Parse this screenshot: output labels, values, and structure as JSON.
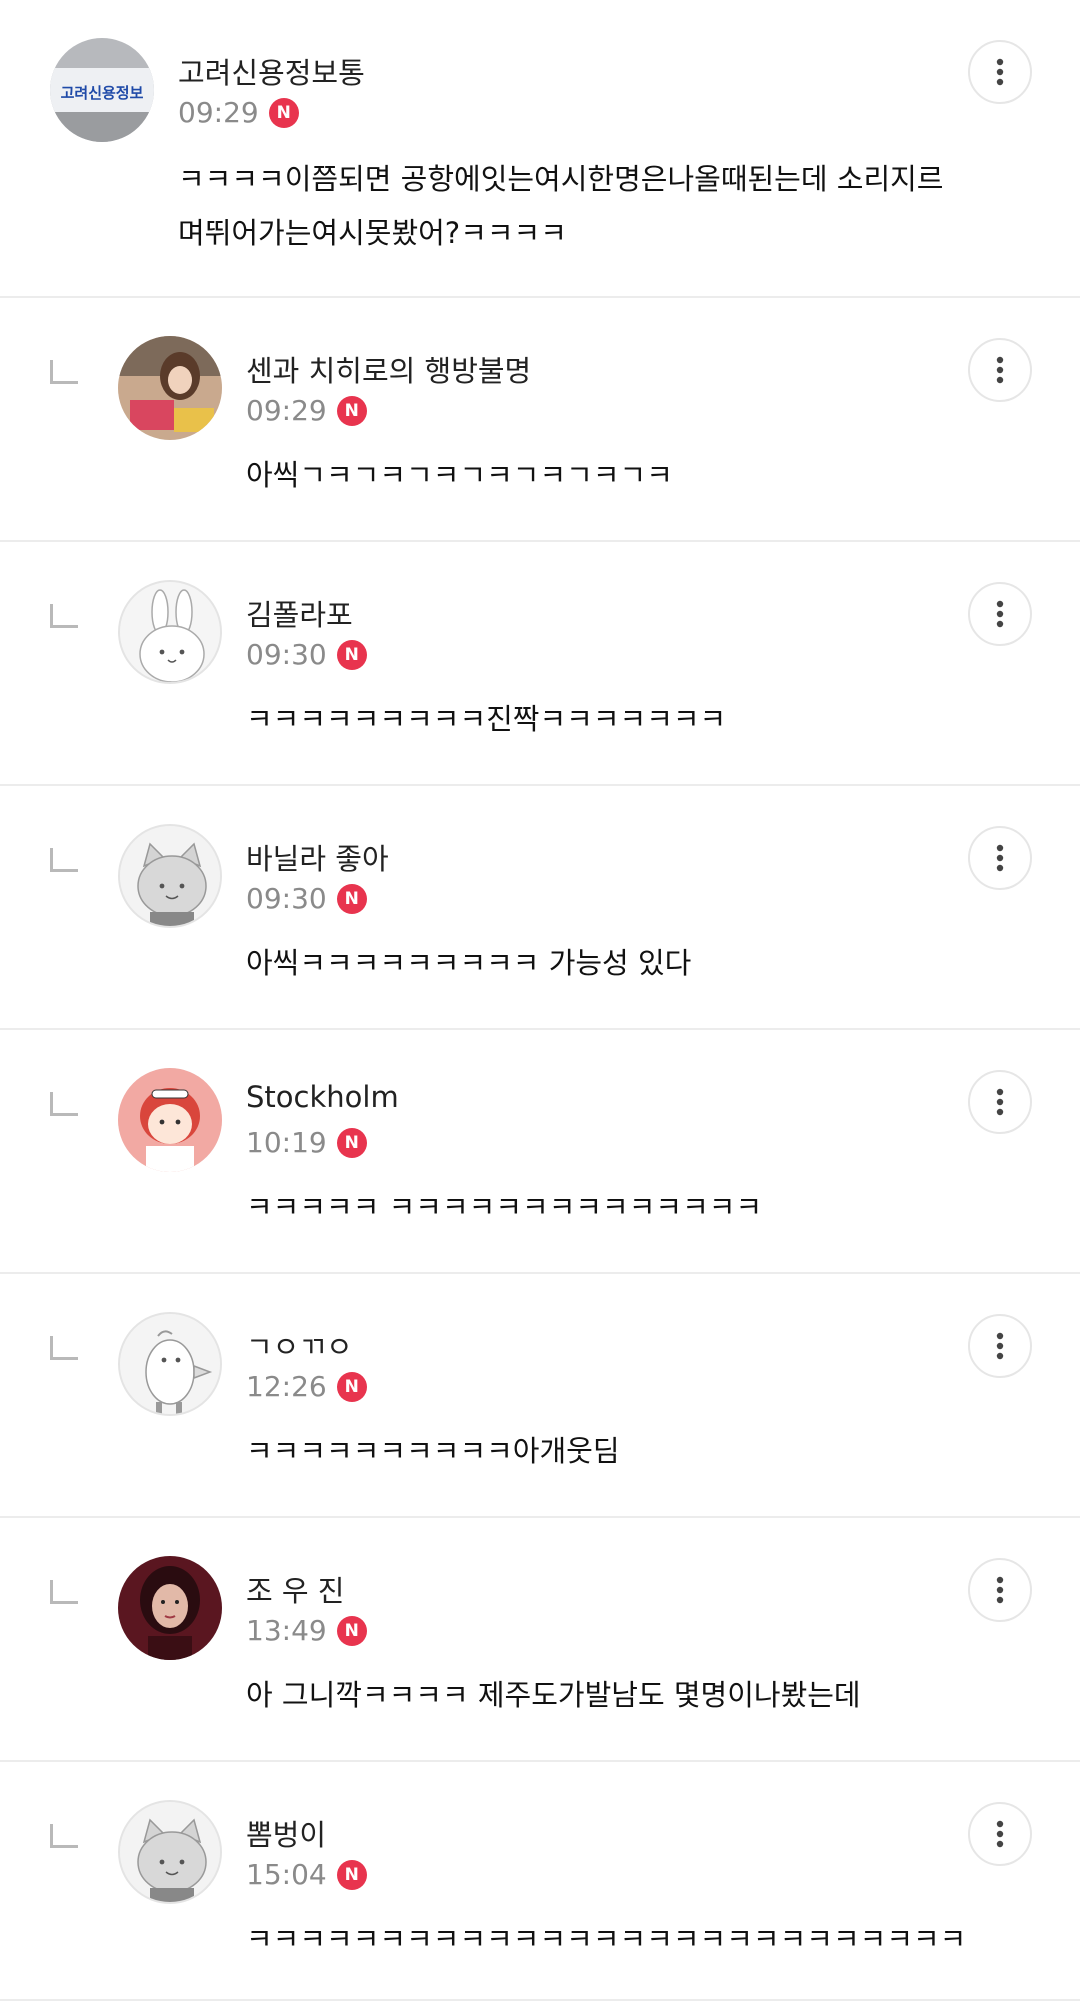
{
  "comments": [
    {
      "nick": "고려신용정보통",
      "time": "09:29",
      "badge": "N",
      "text_lines": [
        "ㅋㅋㅋㅋ이쯤되면 공항에잇는여시한명은나올때된는데 소리지르",
        "며뛰어가는여시못봤어?ㅋㅋㅋㅋ"
      ],
      "avatar_text": "고려신용정보"
    },
    {
      "nick": "센과 치히로의 행방불명",
      "time": "09:29",
      "badge": "N",
      "text_lines": [
        "아씩ㄱㅋㄱㅋㄱㅋㄱㅋㄱㅋㄱㅋㄱㅋ"
      ]
    },
    {
      "nick": "김폴라포",
      "time": "09:30",
      "badge": "N",
      "text_lines": [
        "ㅋㅋㅋㅋㅋㅋㅋㅋㅋ진짝ㅋㅋㅋㅋㅋㅋㅋ"
      ]
    },
    {
      "nick": "바닐라 좋아",
      "time": "09:30",
      "badge": "N",
      "text_lines": [
        "아씩ㅋㅋㅋㅋㅋㅋㅋㅋㅋ 가능성 있다"
      ]
    },
    {
      "nick": "Stockholm",
      "time": "10:19",
      "badge": "N",
      "text_lines": [
        "ㅋㅋㅋㅋㅋ ㅋㅋㅋㅋㅋㅋㅋㅋㅋㅋㅋㅋㅋㅋ"
      ]
    },
    {
      "nick": "ㄱㅇㄲㅇ",
      "time": "12:26",
      "badge": "N",
      "text_lines": [
        "ㅋㅋㅋㅋㅋㅋㅋㅋㅋㅋ아개웃딤"
      ]
    },
    {
      "nick": "조 우 진",
      "time": "13:49",
      "badge": "N",
      "text_lines": [
        "아 그니깍ㅋㅋㅋㅋ 제주도가발남도 몇명이나봤는데"
      ]
    },
    {
      "nick": "뽐벙이",
      "time": "15:04",
      "badge": "N",
      "text_lines": [
        "ㅋㅋㅋㅋㅋㅋㅋㅋㅋㅋㅋㅋㅋㅋㅋㅋㅋㅋㅋㅋㅋㅋㅋㅋㅋㅋㅋ"
      ]
    }
  ],
  "colors": {
    "badge": "#e8344e",
    "divider": "#ececec",
    "meta_text": "#8a8a8a"
  },
  "icons": {
    "more": "vertical-dots-icon",
    "reply": "reply-corner-icon"
  }
}
